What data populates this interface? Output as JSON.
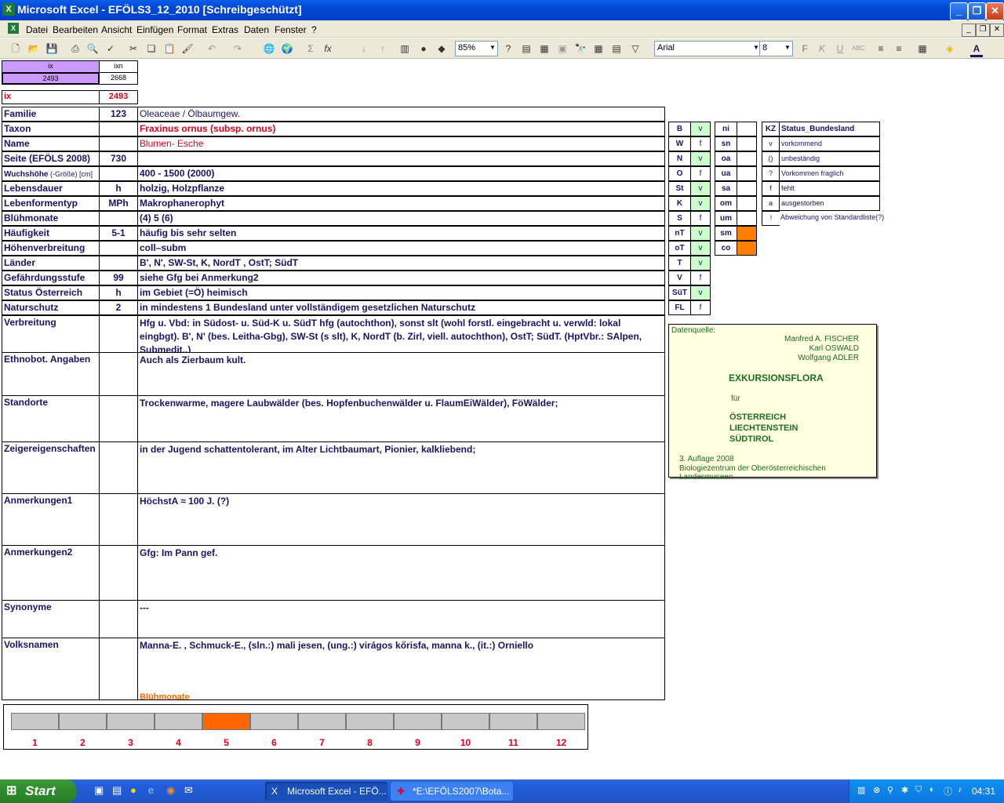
{
  "window": {
    "title": "Microsoft Excel - EFÖLS3_12_2010  [Schreibgeschützt]",
    "app_icon": "excel-icon"
  },
  "menu": [
    "Datei",
    "Bearbeiten",
    "Ansicht",
    "Einfügen",
    "Format",
    "Extras",
    "Daten",
    "Fenster",
    "?"
  ],
  "toolbar": {
    "zoom": "85%",
    "font": "Arial",
    "size": "8"
  },
  "index": {
    "ix_header": "ix",
    "ixn_header": "ixn",
    "ix_value": "2493",
    "ixn_value": "2668",
    "ix_label": "ix",
    "ix_red": "2493"
  },
  "rows": [
    {
      "label": "Familie",
      "code": "123",
      "value": "Oleaceae  /  Ölbaumgew."
    },
    {
      "label": "Taxon",
      "code": "",
      "value": "Fraxinus ornus (subsp. ornus)"
    },
    {
      "label": "Name",
      "code": "",
      "value": "Blumen- Esche"
    },
    {
      "label": "Seite (EFÖLS 2008)",
      "code": "730",
      "value": ""
    },
    {
      "label": "Wuchshöhe",
      "label_suffix": " (-Größe) [cm]",
      "code": "",
      "value": " 400 - 1500 (2000)"
    },
    {
      "label": "Lebensdauer",
      "code": "h",
      "value": "holzig, Holzpflanze"
    },
    {
      "label": "Lebenformentyp",
      "code": "MPh",
      "value": "Makrophanerophyt"
    },
    {
      "label": "Blühmonate",
      "code": "",
      "value": "(4) 5 (6)"
    },
    {
      "label": "Häufigkeit",
      "code": "5-1",
      "value": "häufig bis sehr selten"
    },
    {
      "label": "Höhenverbreitung",
      "code": "",
      "value": "coll–subm"
    },
    {
      "label": "Länder",
      "code": "",
      "value": "B', N', SW-St, K, NordT , OstT; SüdT"
    },
    {
      "label": "Gefährdungsstufe",
      "code": "99",
      "value": "siehe Gfg bei Anmerkung2"
    },
    {
      "label": "Status Österreich",
      "code": "h",
      "value": "im Gebiet (=Ö) heimisch"
    },
    {
      "label": "Naturschutz",
      "code": "2",
      "value": "in mindestens 1 Bundesland unter vollständigem gesetzlichen Naturschutz"
    }
  ],
  "big_rows": [
    {
      "label": "Verbreitung",
      "value": "Hfg u. Vbd: in Südost- u. Süd-K u. SüdT hfg (autochthon), sonst slt (wohl forstl. eingebracht u. verwld: lokal eingbgt). B', N' (bes. Leitha-Gbg), SW-St (s slt), K, NordT (b. Zirl, viell. autochthon), OstT; SüdT. (HptVbr.: SAlpen, Submedit..)"
    },
    {
      "label": "Ethnobot. Angaben",
      "value": "Auch als Zierbaum kult."
    },
    {
      "label": "Standorte",
      "value": "Trockenwarme, magere Laubwälder (bes. Hopfenbuchenwälder u. FlaumEiWälder), FöWälder;"
    },
    {
      "label": "Zeigereigenschaften",
      "value": "in der Jugend schattentolerant, im Alter Lichtbaumart, Pionier, kalkliebend;"
    },
    {
      "label": "Anmerkungen1",
      "value": "HöchstA ≈ 100 J. (?)"
    },
    {
      "label": "Anmerkungen2",
      "value": "Gfg: Im Pann gef."
    },
    {
      "label": "Synonyme",
      "value": "---"
    },
    {
      "label": "Volksnamen",
      "value": "Manna-E. , Schmuck-E., (sln.:) mali jesen, (ung.:) virágos kőrisfa, manna k., (it.:) Orniello"
    }
  ],
  "status_left": [
    {
      "k": "B",
      "v": "v"
    },
    {
      "k": "W",
      "v": "f"
    },
    {
      "k": "N",
      "v": "v"
    },
    {
      "k": "O",
      "v": "f"
    },
    {
      "k": "St",
      "v": "v"
    },
    {
      "k": "K",
      "v": "v"
    },
    {
      "k": "S",
      "v": "f"
    },
    {
      "k": "nT",
      "v": "v"
    },
    {
      "k": "oT",
      "v": "v"
    },
    {
      "k": "T",
      "v": "v"
    },
    {
      "k": "V",
      "v": "f"
    },
    {
      "k": "SüT",
      "v": "v"
    },
    {
      "k": "FL",
      "v": "f"
    }
  ],
  "status_right": [
    {
      "k": "ni",
      "v": ""
    },
    {
      "k": "sn",
      "v": ""
    },
    {
      "k": "oa",
      "v": ""
    },
    {
      "k": "ua",
      "v": ""
    },
    {
      "k": "sa",
      "v": ""
    },
    {
      "k": "om",
      "v": ""
    },
    {
      "k": "um",
      "v": ""
    },
    {
      "k": "sm",
      "v": "",
      "flag": "orange"
    },
    {
      "k": "co",
      "v": "",
      "flag": "orange"
    }
  ],
  "legend": {
    "kz_header": "KZ",
    "title": "Status_Bundesland",
    "items": [
      {
        "k": "v",
        "t": "vorkommend"
      },
      {
        "k": "()",
        "t": "unbeständig"
      },
      {
        "k": "?",
        "t": "Vorkommen fraglich"
      },
      {
        "k": "f",
        "t": "fehlt"
      },
      {
        "k": "a",
        "t": "ausgestorben"
      },
      {
        "k": "!",
        "t": "Abweichung von Standardliste(?)"
      }
    ]
  },
  "source": {
    "label": "Datenquelle:",
    "author1": "Manfred A. FISCHER",
    "author2": "Karl OSWALD",
    "author3": "Wolfgang ADLER",
    "book": "EXKURSIONSFLORA",
    "fuer": "für",
    "c1": "ÖSTERREICH",
    "c2": "LIECHTENSTEIN",
    "c3": "SÜDTIROL",
    "edition": "3. Auflage 2008",
    "publisher": "Biologiezentrum der Oberösterreichischen Landesmuseen"
  },
  "months_chart": {
    "title": "Blühmonate",
    "months": [
      "1",
      "2",
      "3",
      "4",
      "5",
      "6",
      "7",
      "8",
      "9",
      "10",
      "11",
      "12"
    ],
    "active": [
      5
    ],
    "bar_color": "#c8c8c8",
    "active_color": "#ff6600"
  },
  "taskbar": {
    "start": "Start",
    "task1": "Microsoft Excel - EFÖ...",
    "task2": "*E:\\EFÖLS2007\\Bota...",
    "clock": "04:31"
  }
}
